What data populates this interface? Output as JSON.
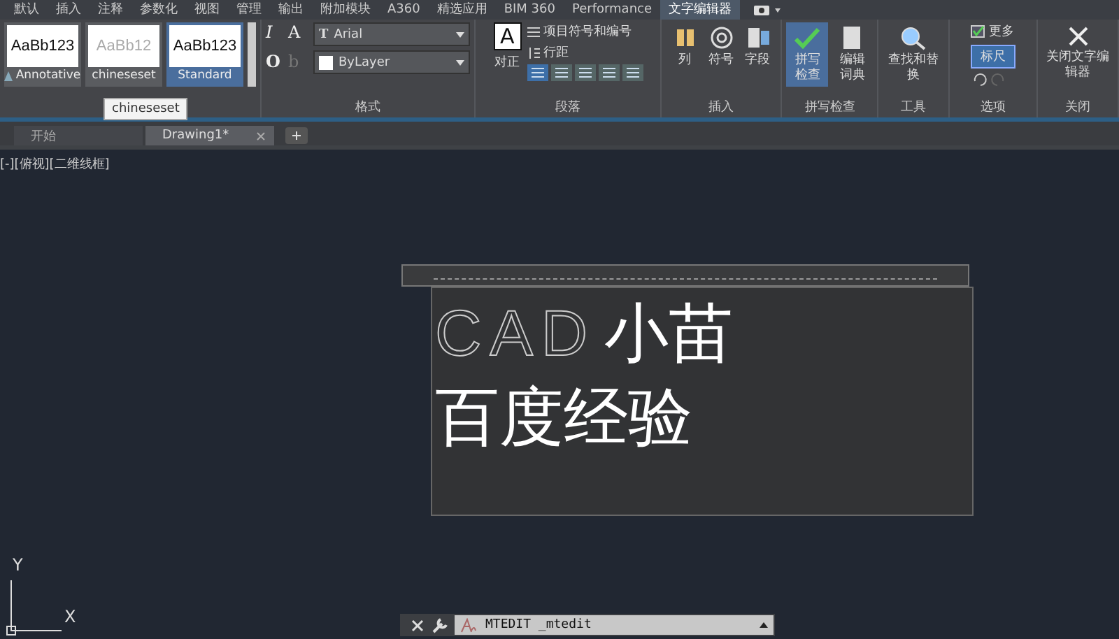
{
  "menu_tabs": [
    {
      "label": "默认",
      "selected": false
    },
    {
      "label": "插入",
      "selected": false
    },
    {
      "label": "注释",
      "selected": false
    },
    {
      "label": "参数化",
      "selected": false
    },
    {
      "label": "视图",
      "selected": false
    },
    {
      "label": "管理",
      "selected": false
    },
    {
      "label": "输出",
      "selected": false
    },
    {
      "label": "附加模块",
      "selected": false
    },
    {
      "label": "A360",
      "selected": false
    },
    {
      "label": "精选应用",
      "selected": false
    },
    {
      "label": "BIM 360",
      "selected": false
    },
    {
      "label": "Performance",
      "selected": false
    },
    {
      "label": "文字编辑器",
      "selected": true
    }
  ],
  "styles": [
    {
      "sample": "AaBb123",
      "name": "Annotative",
      "annotative": true,
      "selected": false,
      "dim": false
    },
    {
      "sample": "AaBb12",
      "name": "chineseset",
      "annotative": false,
      "selected": false,
      "dim": true
    },
    {
      "sample": "AaBb123",
      "name": "Standard",
      "annotative": false,
      "selected": true,
      "dim": false
    }
  ],
  "tooltip": "chineseset",
  "format": {
    "tools": [
      {
        "glyph": "I",
        "disabled": false
      },
      {
        "glyph": "A",
        "disabled": false
      },
      {
        "glyph": "O",
        "disabled": false
      },
      {
        "glyph": "b",
        "disabled": true
      }
    ],
    "font_icon": "T",
    "font": "Arial",
    "layer": "ByLayer",
    "label": "格式"
  },
  "paragraph": {
    "justify_icon": "A",
    "justify": "对正",
    "bullets": "项目符号和编号",
    "spacing": "行距",
    "label": "段落",
    "alignments": [
      {
        "selected": true
      },
      {
        "selected": false
      },
      {
        "selected": false
      },
      {
        "selected": false
      },
      {
        "selected": false
      }
    ]
  },
  "insert": {
    "buttons": [
      {
        "label": "列",
        "kind": "columns"
      },
      {
        "label": "符号",
        "kind": "symbol"
      },
      {
        "label": "字段",
        "kind": "field"
      }
    ],
    "label": "插入"
  },
  "spell": {
    "check": "拼写检查",
    "check_selected": true,
    "dict": "编辑词典",
    "label": "拼写检查"
  },
  "tools": {
    "find": "查找和替换",
    "label": "工具"
  },
  "options": {
    "more": "更多",
    "ruler": "标尺",
    "ruler_on": true,
    "label": "选项"
  },
  "close": {
    "button": "关闭文字编辑器",
    "label": "关闭"
  },
  "doc_tabs": [
    {
      "label": "开始",
      "selected": false,
      "closable": false
    },
    {
      "label": "Drawing1*",
      "selected": true,
      "closable": true
    }
  ],
  "viewport_label": "[-][俯视][二维线框]",
  "editor": {
    "lines": [
      {
        "latin": "CAD",
        "cjk": "小苗"
      },
      {
        "cjk": "百度经验"
      }
    ]
  },
  "ucs": {
    "y": "Y",
    "x": "X"
  },
  "command": "MTEDIT _mtedit"
}
